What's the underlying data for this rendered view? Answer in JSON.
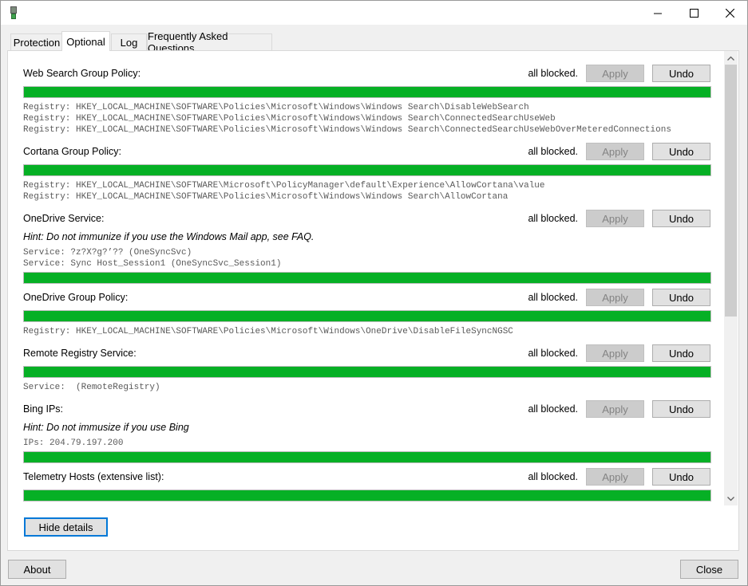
{
  "window": {
    "title": "",
    "icon": "app-icon",
    "controls": [
      "minimize-icon",
      "maximize-icon",
      "close-icon"
    ]
  },
  "tabs": [
    {
      "label": "Protection"
    },
    {
      "label": "Optional"
    },
    {
      "label": "Log"
    },
    {
      "label": "Frequently Asked Questions"
    }
  ],
  "active_tab": "Optional",
  "buttons": {
    "apply": "Apply",
    "undo": "Undo"
  },
  "sections": [
    {
      "title": "Web Search Group Policy:",
      "status": "all blocked.",
      "details": [
        "Registry: HKEY_LOCAL_MACHINE\\SOFTWARE\\Policies\\Microsoft\\Windows\\Windows Search\\DisableWebSearch",
        "Registry: HKEY_LOCAL_MACHINE\\SOFTWARE\\Policies\\Microsoft\\Windows\\Windows Search\\ConnectedSearchUseWeb",
        "Registry: HKEY_LOCAL_MACHINE\\SOFTWARE\\Policies\\Microsoft\\Windows\\Windows Search\\ConnectedSearchUseWebOverMeteredConnections"
      ]
    },
    {
      "title": "Cortana Group Policy:",
      "status": "all blocked.",
      "details": [
        "Registry: HKEY_LOCAL_MACHINE\\SOFTWARE\\Microsoft\\PolicyManager\\default\\Experience\\AllowCortana\\value",
        "Registry: HKEY_LOCAL_MACHINE\\SOFTWARE\\Policies\\Microsoft\\Windows\\Windows Search\\AllowCortana"
      ]
    },
    {
      "title": "OneDrive Service:",
      "status": "all blocked.",
      "hint": "Hint: Do not immunize if you use the Windows Mail app, see FAQ.",
      "details": [
        "Service: ?z?X?g?’?? (OneSyncSvc)",
        "Service: Sync Host_Session1 (OneSyncSvc_Session1)"
      ]
    },
    {
      "title": "OneDrive Group Policy:",
      "status": "all blocked.",
      "details": [
        "Registry: HKEY_LOCAL_MACHINE\\SOFTWARE\\Policies\\Microsoft\\Windows\\OneDrive\\DisableFileSyncNGSC"
      ]
    },
    {
      "title": "Remote Registry Service:",
      "status": "all blocked.",
      "details": [
        "Service:  (RemoteRegistry)"
      ]
    },
    {
      "title": "Bing IPs:",
      "status": "all blocked.",
      "hint": "Hint: Do not immusize if you use Bing",
      "details": [
        "IPs: 204.79.197.200"
      ]
    },
    {
      "title": "Telemetry Hosts (extensive list):",
      "status": "all blocked.",
      "details": []
    }
  ],
  "progress_fill": 1.0,
  "footer": {
    "hide_details": "Hide details",
    "about": "About",
    "close": "Close"
  },
  "colors": {
    "progress": "#06b025",
    "focus_border": "#0078d7"
  }
}
